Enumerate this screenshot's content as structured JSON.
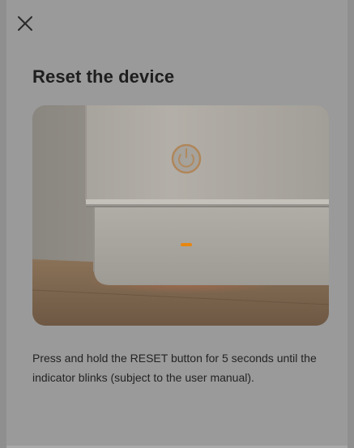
{
  "header": {
    "close_icon": "close-icon"
  },
  "content": {
    "title": "Reset the device",
    "illustration_icon": "device-reset-illustration",
    "instruction": "Press and hold the RESET button for 5 seconds until the indicator blinks (subject to the user manual)."
  },
  "colors": {
    "overlay_background": "#9a9a9a",
    "indicator_orange": "#e8860f",
    "text_primary": "#1e1e1e"
  }
}
